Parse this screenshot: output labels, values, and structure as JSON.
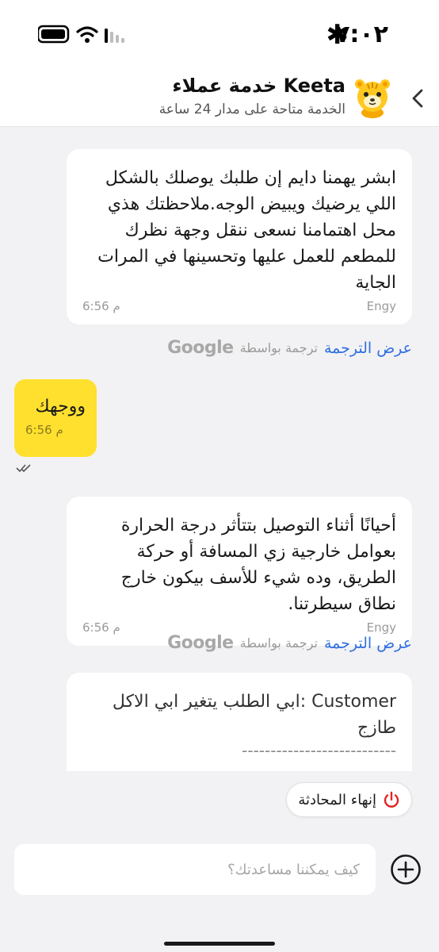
{
  "status_bar": {
    "time": "٧:٠٢",
    "extra_icon": "asterisk-icon",
    "icons": [
      "battery-icon",
      "wifi-icon",
      "signal-icon"
    ]
  },
  "header": {
    "title": "خدمة عملاء Keeta",
    "subtitle": "الخدمة متاحة على مدار 24 ساعة",
    "avatar": "tiger-mascot-icon",
    "back_icon": "chevron-right-icon"
  },
  "messages": [
    {
      "direction": "incoming",
      "text": "ابشر يهمنا دايم إن طلبك يوصلك بالشكل اللي يرضيك ويبيض الوجه.ملاحظتك هذي محل اهتمامنا نسعى ننقل وجهة نظرك للمطعم للعمل عليها وتحسينها في المرات الجاية",
      "sender": "Engy",
      "time": "6:56 م"
    },
    {
      "direction": "outgoing",
      "text": "ووجهك",
      "time": "6:56 م",
      "status": "double-check-icon"
    },
    {
      "direction": "incoming",
      "text": "أحيانًا أثناء التوصيل بتتأثر درجة الحرارة بعوامل خارجية زي المسافة أو حركة الطريق، وده شيء للأسف بيكون خارج نطاق سيطرتنا.",
      "sender": "Engy",
      "time": "6:56 م"
    }
  ],
  "translation": {
    "show_label": "عرض الترجمة",
    "by_label": "ترجمة بواسطة",
    "provider": "Google"
  },
  "card": {
    "line1": "Customer :ابي الطلب يتغير ابي الاكل طازج",
    "divider": "---------------------------"
  },
  "actions": {
    "end_chat_label": "إنهاء المحادثة",
    "end_chat_icon": "power-icon"
  },
  "composer": {
    "placeholder": "كيف يمكننا مساعدتك؟",
    "value": "",
    "add_icon": "plus-circle-icon"
  },
  "colors": {
    "accent": "#ffe02e",
    "link": "#2f6fe0",
    "end_chat_icon": "#e02424",
    "background": "#f2f2f4"
  }
}
